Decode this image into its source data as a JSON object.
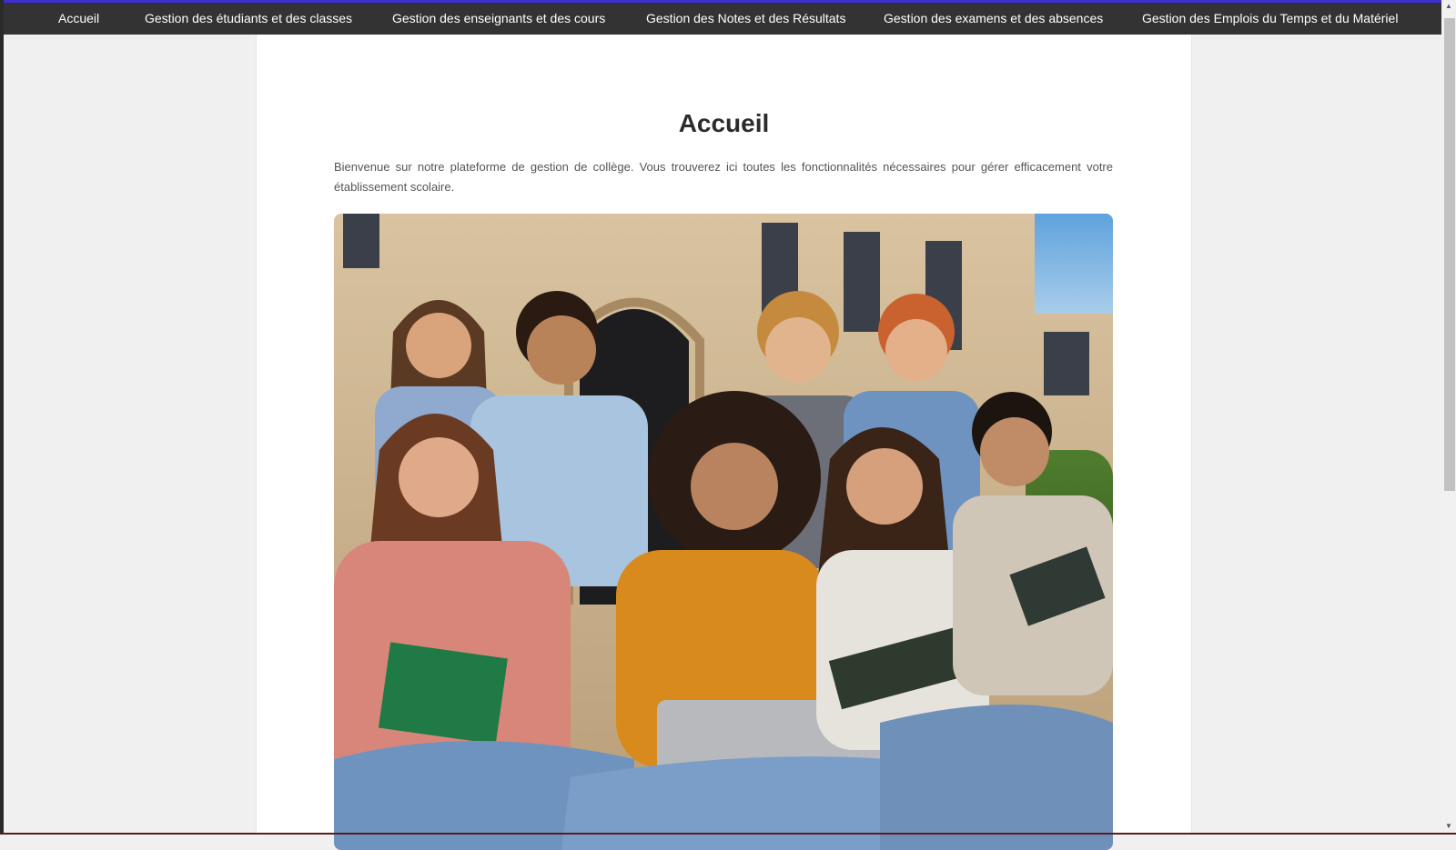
{
  "nav": {
    "items": [
      {
        "label": "Accueil"
      },
      {
        "label": "Gestion des étudiants et des classes"
      },
      {
        "label": "Gestion des enseignants et des cours"
      },
      {
        "label": "Gestion des Notes et des Résultats"
      },
      {
        "label": "Gestion des examens et des absences"
      },
      {
        "label": "Gestion des Emplois du Temps et du Matériel"
      }
    ]
  },
  "main": {
    "title": "Accueil",
    "intro": "Bienvenue sur notre plateforme de gestion de collège. Vous trouverez ici toutes les fonctionnalités nécessaires pour gérer efficacement votre établissement scolaire."
  },
  "colors": {
    "navbar": "#333333",
    "accent_line": "#3b2fd4",
    "page_bg": "#f0f0f0"
  }
}
